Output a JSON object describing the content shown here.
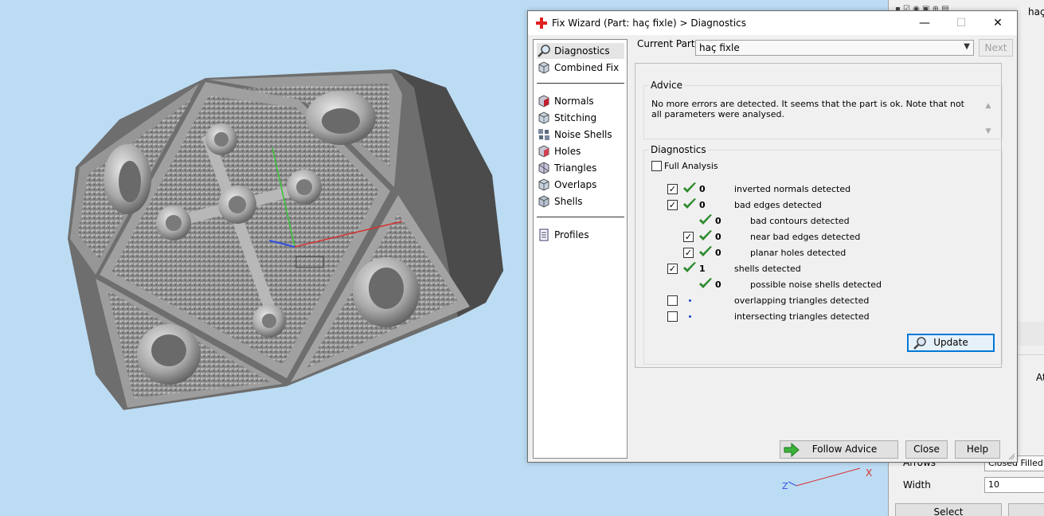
{
  "dialog": {
    "title": "Fix Wizard (Part: haç fixle) > Diagnostics",
    "minimize_glyph": "—",
    "maximize_glyph": "☐",
    "close_glyph": "✕",
    "current_part_label": "Current Part:",
    "current_part_value": "haç fixle",
    "next_label": "Next",
    "nav": {
      "group1": [
        {
          "label": "Diagnostics",
          "icon": "magnifier-icon"
        },
        {
          "label": "Combined Fix",
          "icon": "cube-icon"
        }
      ],
      "group2": [
        {
          "label": "Normals",
          "icon": "normals-icon"
        },
        {
          "label": "Stitching",
          "icon": "stitching-icon"
        },
        {
          "label": "Noise Shells",
          "icon": "noise-shells-icon"
        },
        {
          "label": "Holes",
          "icon": "holes-icon"
        },
        {
          "label": "Triangles",
          "icon": "triangles-icon"
        },
        {
          "label": "Overlaps",
          "icon": "overlaps-icon"
        },
        {
          "label": "Shells",
          "icon": "shells-icon"
        }
      ],
      "group3": [
        {
          "label": "Profiles",
          "icon": "document-icon"
        }
      ]
    },
    "advice": {
      "title": "Advice",
      "text": "No more errors are detected. It seems that the part is ok. Note that not all parameters were analysed."
    },
    "diagnostics": {
      "title": "Diagnostics",
      "full_analysis_label": "Full Analysis",
      "full_analysis_checked": false,
      "rows": [
        {
          "checkbox": true,
          "checked": true,
          "status": "ok",
          "count": "0",
          "label": "inverted normals detected",
          "indent": 0
        },
        {
          "checkbox": true,
          "checked": true,
          "status": "ok",
          "count": "0",
          "label": "bad edges detected",
          "indent": 0
        },
        {
          "checkbox": false,
          "checked": false,
          "status": "ok",
          "count": "0",
          "label": "bad contours detected",
          "indent": 1
        },
        {
          "checkbox": true,
          "checked": true,
          "status": "ok",
          "count": "0",
          "label": "near bad edges detected",
          "indent": 1
        },
        {
          "checkbox": true,
          "checked": true,
          "status": "ok",
          "count": "0",
          "label": "planar holes detected",
          "indent": 1
        },
        {
          "checkbox": true,
          "checked": true,
          "status": "ok",
          "count": "1",
          "label": "shells detected",
          "indent": 0
        },
        {
          "checkbox": false,
          "checked": false,
          "status": "ok",
          "count": "0",
          "label": "possible noise shells detected",
          "indent": 1
        },
        {
          "checkbox": true,
          "checked": false,
          "status": "pending",
          "count": "",
          "label": "overlapping triangles detected",
          "indent": 0
        },
        {
          "checkbox": true,
          "checked": false,
          "status": "pending",
          "count": "",
          "label": "intersecting triangles detected",
          "indent": 0
        }
      ],
      "update_label": "Update"
    },
    "buttons": {
      "follow_advice": "Follow Advice",
      "close": "Close",
      "help": "Help"
    }
  },
  "side_panel": {
    "top_text": "haç",
    "partial_label": "At",
    "arrows_label": "Arrows",
    "arrows_value": "Closed Filled",
    "width_label": "Width",
    "width_value": "10",
    "select_label": "Select"
  },
  "viewport": {
    "axis_tag": "Z",
    "axis_x_tag": "X"
  },
  "colors": {
    "viewport_bg": "#bcdcf4",
    "check_green": "#2e8b2e",
    "accent_blue": "#0078d7",
    "title_red": "#e02020"
  }
}
